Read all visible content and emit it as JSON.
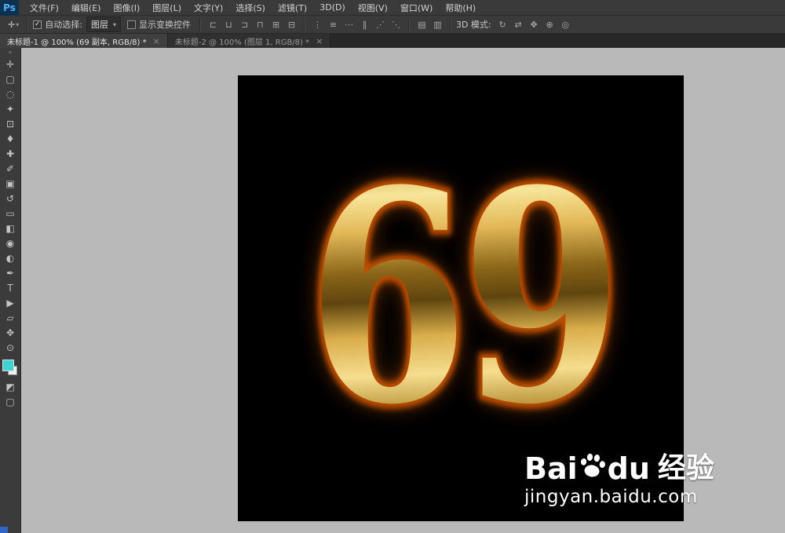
{
  "icons": {
    "chevron_down": "▾",
    "close": "×",
    "check": "✓",
    "collapse": "»"
  },
  "menubar": {
    "logo": "Ps",
    "items": [
      {
        "label": "文件(F)"
      },
      {
        "label": "编辑(E)"
      },
      {
        "label": "图像(I)"
      },
      {
        "label": "图层(L)"
      },
      {
        "label": "文字(Y)"
      },
      {
        "label": "选择(S)"
      },
      {
        "label": "滤镜(T)"
      },
      {
        "label": "3D(D)"
      },
      {
        "label": "视图(V)"
      },
      {
        "label": "窗口(W)"
      },
      {
        "label": "帮助(H)"
      }
    ]
  },
  "options_bar": {
    "tool_preset_glyph": "✛",
    "auto_select": {
      "label": "自动选择:",
      "checked": true
    },
    "target_dropdown": {
      "value": "图层"
    },
    "show_transform": {
      "label": "显示变换控件",
      "checked": false
    },
    "mode_3d_label": "3D 模式:",
    "align_icons": [
      {
        "name": "align-left-edges",
        "glyph": "⊏"
      },
      {
        "name": "align-horizontal-centers",
        "glyph": "⊔"
      },
      {
        "name": "align-right-edges",
        "glyph": "⊐"
      },
      {
        "name": "align-top-edges",
        "glyph": "⊓"
      },
      {
        "name": "align-vertical-centers",
        "glyph": "⊞"
      },
      {
        "name": "align-bottom-edges",
        "glyph": "⊟"
      }
    ],
    "distribute_icons": [
      {
        "name": "distribute-top-edges",
        "glyph": "⋮"
      },
      {
        "name": "distribute-vertical-centers",
        "glyph": "≡"
      },
      {
        "name": "distribute-bottom-edges",
        "glyph": "⋯"
      },
      {
        "name": "distribute-left-edges",
        "glyph": "∥"
      },
      {
        "name": "distribute-horizontal-centers",
        "glyph": "⋰"
      },
      {
        "name": "distribute-right-edges",
        "glyph": "⋱"
      }
    ],
    "extra_icons": [
      {
        "name": "auto-align-layers",
        "glyph": "▤"
      },
      {
        "name": "auto-blend-layers",
        "glyph": "▥"
      }
    ],
    "mode_3d_icons": [
      {
        "name": "3d-rotate",
        "glyph": "↻"
      },
      {
        "name": "3d-roll",
        "glyph": "⇄"
      },
      {
        "name": "3d-pan",
        "glyph": "✥"
      },
      {
        "name": "3d-slide",
        "glyph": "⊕"
      },
      {
        "name": "3d-scale",
        "glyph": "◎"
      }
    ]
  },
  "tabs": [
    {
      "title": "未标题-1 @ 100% (69 副本, RGB/8) *",
      "active": true
    },
    {
      "title": "未标题-2 @ 100% (图层 1, RGB/8) *",
      "active": false
    }
  ],
  "toolbar": {
    "tools": [
      {
        "name": "move-tool",
        "glyph": "✛"
      },
      {
        "name": "rectangular-marquee-tool",
        "glyph": "▢"
      },
      {
        "name": "lasso-tool",
        "glyph": "◌"
      },
      {
        "name": "quick-selection-tool",
        "glyph": "✦"
      },
      {
        "name": "crop-tool",
        "glyph": "⊡"
      },
      {
        "name": "eyedropper-tool",
        "glyph": "♦"
      },
      {
        "name": "spot-healing-brush-tool",
        "glyph": "✚"
      },
      {
        "name": "brush-tool",
        "glyph": "✐"
      },
      {
        "name": "clone-stamp-tool",
        "glyph": "▣"
      },
      {
        "name": "history-brush-tool",
        "glyph": "↺"
      },
      {
        "name": "eraser-tool",
        "glyph": "▭"
      },
      {
        "name": "gradient-tool",
        "glyph": "◧"
      },
      {
        "name": "blur-tool",
        "glyph": "◉"
      },
      {
        "name": "dodge-tool",
        "glyph": "◐"
      },
      {
        "name": "pen-tool",
        "glyph": "✒"
      },
      {
        "name": "horizontal-type-tool",
        "glyph": "T"
      },
      {
        "name": "path-selection-tool",
        "glyph": "▶"
      },
      {
        "name": "rectangle-tool",
        "glyph": "▱"
      },
      {
        "name": "hand-tool",
        "glyph": "✥"
      },
      {
        "name": "zoom-tool",
        "glyph": "⊙"
      }
    ],
    "foreground_color": "#3fd4d4",
    "background_color": "#f0f0f0",
    "bottom_icons": [
      {
        "name": "quick-mask-mode",
        "glyph": "◩"
      },
      {
        "name": "screen-mode",
        "glyph": "▢"
      }
    ]
  },
  "document": {
    "text": "69",
    "background": "#000000",
    "gold_highlight": "#f7e59a",
    "gold_mid": "#d9ad4a",
    "gold_dark": "#6b4c10",
    "glow_color": "#bf4e00"
  },
  "watermark": {
    "brand_left": "Bai",
    "brand_right": "du",
    "brand_cn": "经验",
    "url": "jingyan.baidu.com"
  }
}
